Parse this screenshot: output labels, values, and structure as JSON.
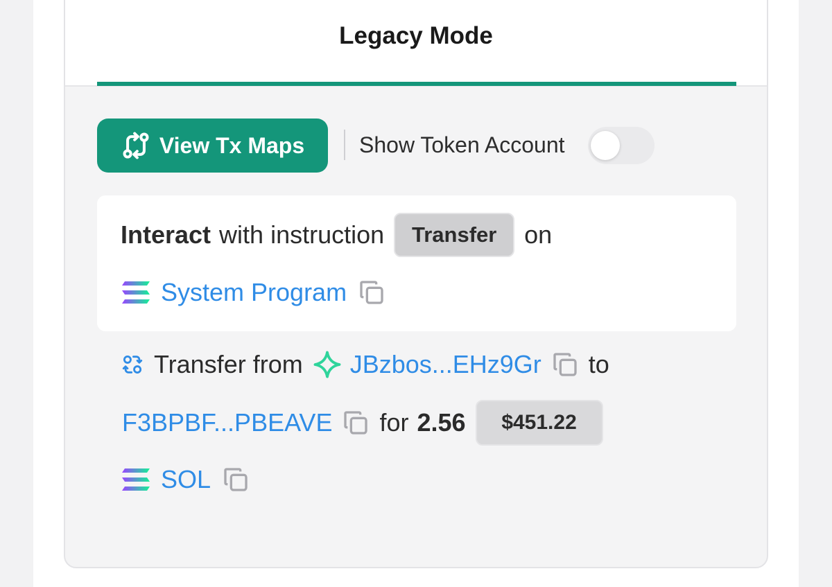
{
  "tab": {
    "title": "Legacy Mode"
  },
  "toolbar": {
    "view_tx_maps_label": "View Tx Maps",
    "show_token_account_label": "Show Token Account",
    "show_token_account_on": false
  },
  "interact": {
    "verb": "Interact",
    "middle_text": "with instruction",
    "instruction": "Transfer",
    "suffix": "on",
    "program": "System Program"
  },
  "transfer": {
    "prefix": "Transfer from",
    "from_address": "JBzbos...EHz9Gr",
    "to_word": "to",
    "to_address": "F3BPBF...PBEAVE",
    "for_word": "for",
    "amount": "2.56",
    "usd_value": "$451.22",
    "token": "SOL"
  },
  "colors": {
    "accent": "#14967a",
    "link": "#2f8ce6",
    "star": "#2fd49b"
  },
  "icons": {
    "tx_maps": "git-compare-icon",
    "sol_logo": "solana-logo-icon",
    "copy": "copy-icon",
    "swap": "swap-icon",
    "wallet_star": "sparkle-star-icon"
  }
}
